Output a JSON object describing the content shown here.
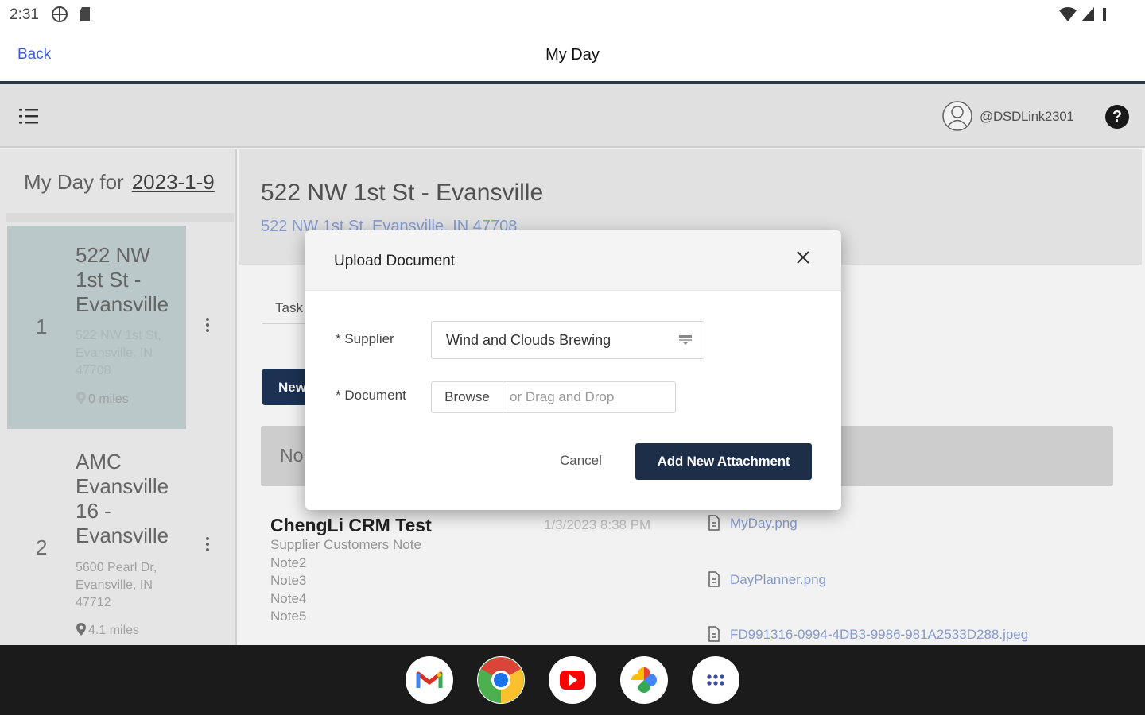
{
  "status_bar": {
    "time": "2:31",
    "icons": [
      "globe-icon",
      "sd-card-icon",
      "wifi-icon",
      "cell-signal-icon",
      "battery-icon"
    ]
  },
  "nav": {
    "back_label": "Back",
    "title": "My Day"
  },
  "toolbar": {
    "username": "@DSDLink2301",
    "help_label": "?"
  },
  "sidebar": {
    "header_label": "My Day for",
    "date": "2023-1-9",
    "stops": [
      {
        "number": "1",
        "name": "522 NW 1st St - Evansville",
        "address": "522 NW 1st St, Evansville, IN 47708",
        "distance": "0 miles"
      },
      {
        "number": "2",
        "name": "AMC Evansville 16 - Evansville",
        "address": "5600 Pearl Dr, Evansville, IN 47712",
        "distance": "4.1 miles"
      }
    ]
  },
  "main": {
    "location_title": "522 NW 1st St - Evansville",
    "location_address": "522 NW 1st St, Evansville, IN 47708",
    "tab_label": "Task",
    "new_button_label": "New",
    "notice_text": "No",
    "note": {
      "title": "ChengLi CRM Test",
      "date": "1/3/2023 8:38 PM",
      "lines": [
        "Supplier Customers Note",
        "Note2",
        "Note3",
        "Note4",
        "Note5"
      ]
    },
    "attachments": [
      "MyDay.png",
      "DayPlanner.png",
      "FD991316-0994-4DB3-9986-981A2533D288.jpeg"
    ]
  },
  "modal": {
    "title": "Upload Document",
    "supplier_label": "* Supplier",
    "supplier_value": "Wind and Clouds Brewing",
    "document_label": "* Document",
    "browse_label": "Browse",
    "drop_label": "or Drag and Drop",
    "cancel_label": "Cancel",
    "submit_label": "Add New Attachment"
  },
  "dock": {
    "apps": [
      "gmail-icon",
      "chrome-icon",
      "youtube-icon",
      "photos-icon",
      "app-drawer-icon"
    ]
  },
  "colors": {
    "primary_button": "#1d2e48",
    "link": "#3d5bd6",
    "selected_stop": "#c5d3d5"
  }
}
